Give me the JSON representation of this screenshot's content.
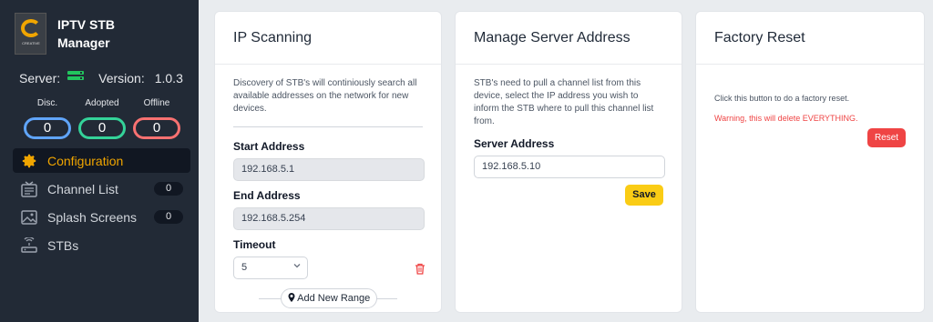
{
  "app": {
    "logo_text": "CREATIVE",
    "title_line1": "IPTV STB",
    "title_line2": "Manager"
  },
  "status": {
    "server_label": "Server:",
    "version_label": "Version:",
    "version_value": "1.0.3"
  },
  "counts": [
    {
      "label": "Disc.",
      "value": "0",
      "color": "#60a5fa"
    },
    {
      "label": "Adopted",
      "value": "0",
      "color": "#34d399"
    },
    {
      "label": "Offline",
      "value": "0",
      "color": "#f87171"
    }
  ],
  "nav": [
    {
      "label": "Configuration",
      "icon": "gear-icon",
      "active": true
    },
    {
      "label": "Channel List",
      "icon": "tv-icon",
      "badge": "0"
    },
    {
      "label": "Splash Screens",
      "icon": "image-icon",
      "badge": "0"
    },
    {
      "label": "STBs",
      "icon": "router-icon"
    }
  ],
  "ip_scanning": {
    "title": "IP Scanning",
    "description": "Discovery of STB's will continiously search all available addresses on the network for new devices.",
    "start_label": "Start Address",
    "start_value": "192.168.5.1",
    "end_label": "End Address",
    "end_value": "192.168.5.254",
    "timeout_label": "Timeout",
    "timeout_value": "5",
    "add_range_label": "Add New Range"
  },
  "server_address": {
    "title": "Manage Server Address",
    "description": "STB's need to pull a channel list from this device, select the IP address you wish to inform the STB where to pull this channel list from.",
    "field_label": "Server Address",
    "field_value": "192.168.5.10",
    "save_label": "Save"
  },
  "factory_reset": {
    "title": "Factory Reset",
    "description": "Click this button to do a factory reset.",
    "warning": "Warning, this will delete EVERYTHING.",
    "reset_label": "Reset"
  },
  "colors": {
    "accent": "#f0a500",
    "save_button": "#facc15",
    "reset_button": "#ef4444",
    "warning_text": "#ef4444"
  }
}
